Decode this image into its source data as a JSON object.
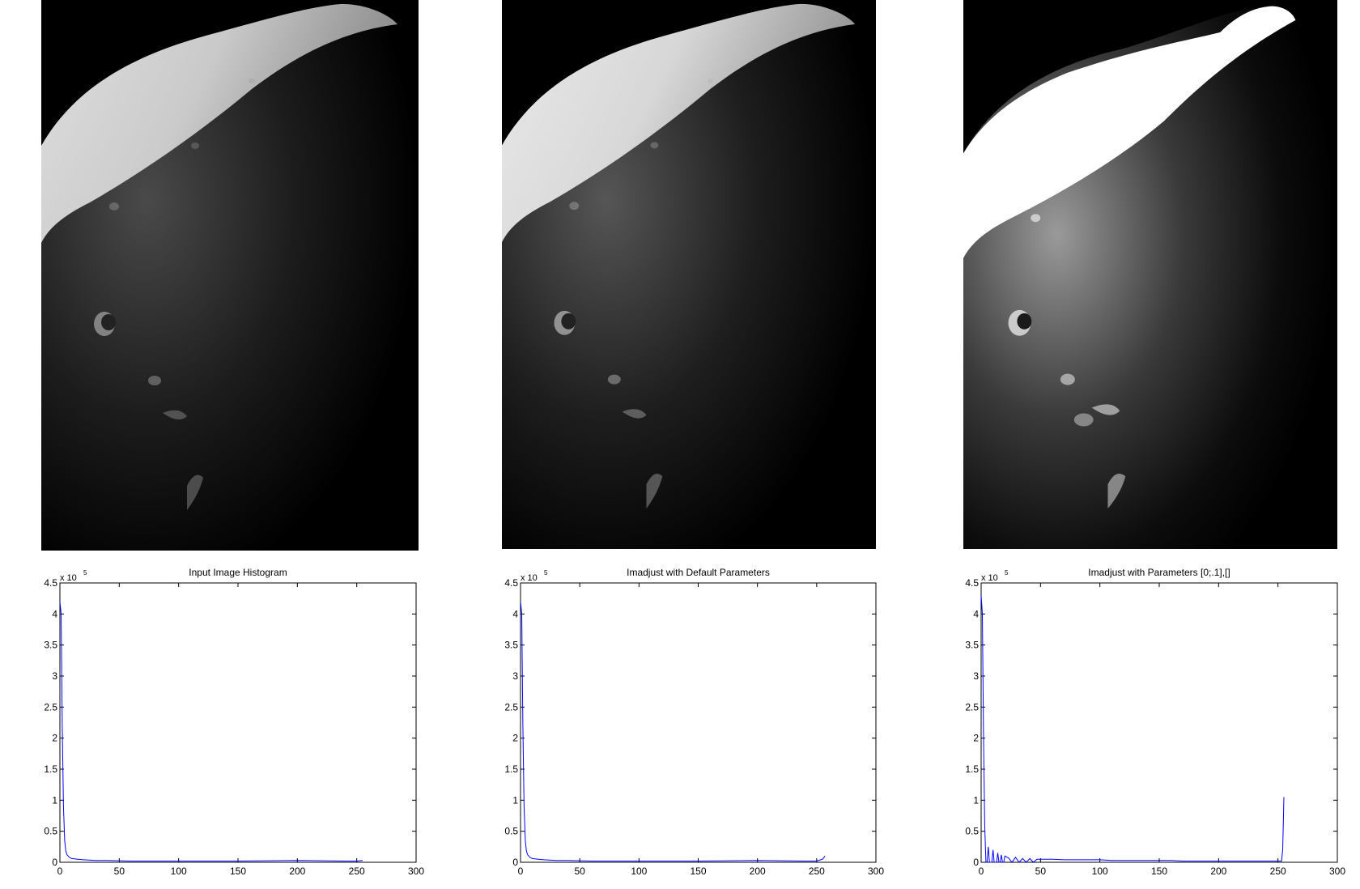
{
  "figure": {
    "background": "#ffffff",
    "panels": [
      {
        "image_label": "phobos-input-image",
        "image_style": "default"
      },
      {
        "image_label": "phobos-imadjust-default",
        "image_style": "default-contrast"
      },
      {
        "image_label": "phobos-imadjust-clipped",
        "image_style": "saturated"
      }
    ]
  },
  "chart_data": [
    {
      "type": "line",
      "title": "Input Image Histogram",
      "xlabel": "",
      "ylabel": "",
      "xlim": [
        0,
        300
      ],
      "ylim": [
        0,
        4.5
      ],
      "y_multiplier_label": "x 10",
      "y_multiplier_exponent": "5",
      "xticks": [
        "0",
        "50",
        "100",
        "150",
        "200",
        "250",
        "300"
      ],
      "yticks": [
        "0",
        "0.5",
        "1",
        "1.5",
        "2",
        "2.5",
        "3",
        "3.5",
        "4",
        "4.5"
      ],
      "grid": false,
      "line_color": "#0000ff",
      "series": [
        {
          "x": [
            0,
            1,
            2,
            3,
            4,
            5,
            6,
            8,
            10,
            15,
            20,
            30,
            40,
            60,
            100,
            150,
            200,
            240,
            250,
            255
          ],
          "values": [
            4.2,
            4.0,
            2.2,
            0.9,
            0.35,
            0.18,
            0.12,
            0.08,
            0.06,
            0.05,
            0.04,
            0.03,
            0.03,
            0.02,
            0.02,
            0.02,
            0.03,
            0.02,
            0.02,
            0.03
          ]
        }
      ]
    },
    {
      "type": "line",
      "title": "Imadjust with Default Parameters",
      "xlabel": "",
      "ylabel": "",
      "xlim": [
        0,
        300
      ],
      "ylim": [
        0,
        4.5
      ],
      "y_multiplier_label": "x 10",
      "y_multiplier_exponent": "5",
      "xticks": [
        "0",
        "50",
        "100",
        "150",
        "200",
        "250",
        "300"
      ],
      "yticks": [
        "0",
        "0.5",
        "1",
        "1.5",
        "2",
        "2.5",
        "3",
        "3.5",
        "4",
        "4.5"
      ],
      "grid": false,
      "line_color": "#0000ff",
      "series": [
        {
          "x": [
            0,
            1,
            2,
            3,
            4,
            5,
            6,
            8,
            10,
            15,
            20,
            30,
            40,
            60,
            100,
            150,
            200,
            240,
            250,
            255,
            257
          ],
          "values": [
            4.2,
            4.0,
            2.2,
            0.9,
            0.35,
            0.18,
            0.12,
            0.08,
            0.06,
            0.05,
            0.04,
            0.03,
            0.03,
            0.02,
            0.02,
            0.02,
            0.03,
            0.02,
            0.02,
            0.05,
            0.1
          ]
        }
      ]
    },
    {
      "type": "line",
      "title": "Imadjust with Parameters [0;.1],[]",
      "xlabel": "",
      "ylabel": "",
      "xlim": [
        0,
        300
      ],
      "ylim": [
        0,
        4.5
      ],
      "y_multiplier_label": "x 10",
      "y_multiplier_exponent": "5",
      "xticks": [
        "0",
        "50",
        "100",
        "150",
        "200",
        "250",
        "300"
      ],
      "yticks": [
        "0",
        "0.5",
        "1",
        "1.5",
        "2",
        "2.5",
        "3",
        "3.5",
        "4",
        "4.5"
      ],
      "grid": false,
      "line_color": "#0000ff",
      "series": [
        {
          "x": [
            0,
            1,
            2,
            3,
            4,
            5,
            6,
            7,
            8,
            9,
            10,
            11,
            12,
            13,
            14,
            15,
            16,
            17,
            18,
            19,
            20,
            23,
            26,
            29,
            32,
            35,
            38,
            41,
            44,
            47,
            50,
            60,
            70,
            80,
            90,
            100,
            110,
            120,
            130,
            140,
            150,
            160,
            170,
            180,
            190,
            200,
            210,
            220,
            230,
            240,
            250,
            253,
            254,
            255
          ],
          "values": [
            4.3,
            4.0,
            2.1,
            0.6,
            0.0,
            0.0,
            0.25,
            0.0,
            0.0,
            0.0,
            0.2,
            0.0,
            0.0,
            0.0,
            0.15,
            0.0,
            0.0,
            0.12,
            0.0,
            0.0,
            0.1,
            0.07,
            0.0,
            0.08,
            0.0,
            0.06,
            0.0,
            0.06,
            0.0,
            0.05,
            0.05,
            0.05,
            0.04,
            0.04,
            0.04,
            0.04,
            0.03,
            0.03,
            0.03,
            0.03,
            0.03,
            0.03,
            0.02,
            0.02,
            0.02,
            0.02,
            0.02,
            0.02,
            0.02,
            0.02,
            0.02,
            0.02,
            0.2,
            1.05
          ]
        }
      ]
    }
  ]
}
